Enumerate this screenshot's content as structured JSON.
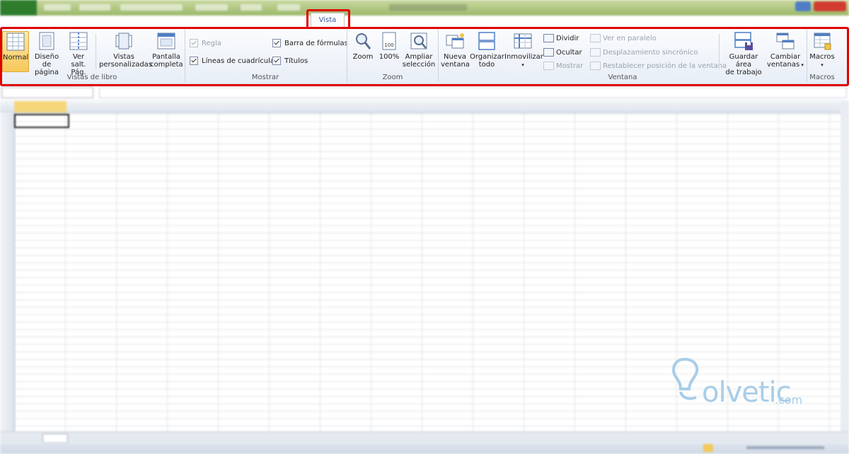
{
  "tabs": {
    "active": "Vista"
  },
  "ribbon": {
    "groups": {
      "vistas_de_libro": {
        "label": "Vistas de libro",
        "normal": "Normal",
        "diseno_l1": "Diseño",
        "diseno_l2": "de página",
        "versalt_l1": "Ver salt.",
        "versalt_l2": "Pág.",
        "vistas_l1": "Vistas",
        "vistas_l2": "personalizadas",
        "pantalla_l1": "Pantalla",
        "pantalla_l2": "completa"
      },
      "mostrar": {
        "label": "Mostrar",
        "regla": "Regla",
        "lineas": "Líneas de cuadrícula",
        "barra": "Barra de fórmulas",
        "titulos": "Títulos"
      },
      "zoom": {
        "label": "Zoom",
        "zoom": "Zoom",
        "cien": "100%",
        "ampliar_l1": "Ampliar",
        "ampliar_l2": "selección"
      },
      "ventana": {
        "label": "Ventana",
        "nueva_l1": "Nueva",
        "nueva_l2": "ventana",
        "organizar_l1": "Organizar",
        "organizar_l2": "todo",
        "inmovilizar": "Inmovilizar",
        "dividir": "Dividir",
        "ocultar": "Ocultar",
        "mostrar": "Mostrar",
        "paralelo": "Ver en paralelo",
        "desplazamiento": "Desplazamiento sincrónico",
        "restablecer": "Restablecer posición de la ventana",
        "guardar_l1": "Guardar área",
        "guardar_l2": "de trabajo",
        "cambiar_l1": "Cambiar",
        "cambiar_l2": "ventanas"
      },
      "macros": {
        "label": "Macros",
        "macros": "Macros"
      }
    }
  },
  "watermark": {
    "word": "olvetic",
    "suffix": ".com"
  },
  "colors": {
    "highlight": "#e00000",
    "watermark": "#a8cde8"
  }
}
